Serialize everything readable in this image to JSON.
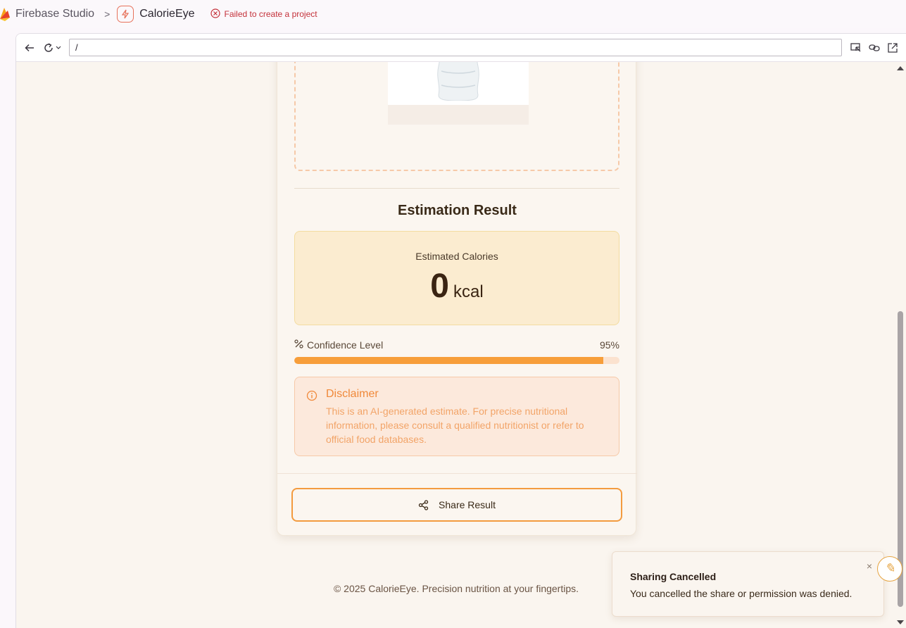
{
  "studio": {
    "title": "Firebase Studio",
    "project": "CalorieEye",
    "error": "Failed to create a project"
  },
  "browser": {
    "url": "/"
  },
  "result": {
    "title": "Estimation Result",
    "calories_label": "Estimated Calories",
    "calories_value": "0",
    "calories_unit": "kcal",
    "confidence_label": "Confidence Level",
    "confidence_value": "95%",
    "confidence_fraction": 0.95
  },
  "disclaimer": {
    "title": "Disclaimer",
    "text": "This is an AI-generated estimate. For precise nutritional information, please consult a qualified nutritionist or refer to official food databases."
  },
  "share_button": "Share Result",
  "footer": "© 2025 CalorieEye. Precision nutrition at your fingertips.",
  "toast": {
    "title": "Sharing Cancelled",
    "message": "You cancelled the share or permission was denied.",
    "close": "×"
  },
  "colors": {
    "accent": "#f79e3a",
    "error": "#c4313a",
    "disclaimer": "#f0893a"
  },
  "icons": [
    "firebase-icon",
    "calorie-eye-icon",
    "error-icon",
    "back-icon",
    "reload-icon",
    "inspect-icon",
    "link-icon",
    "open-external-icon",
    "percent-icon",
    "info-icon",
    "share-icon",
    "close-icon"
  ]
}
